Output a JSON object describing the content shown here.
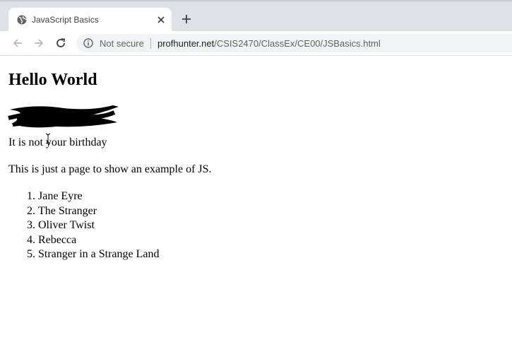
{
  "browser": {
    "tab": {
      "title": "JavaScript Basics",
      "favicon": "globe-icon",
      "close_icon": "close-icon"
    },
    "new_tab_icon": "plus-icon",
    "nav": {
      "back_icon": "back-arrow-icon",
      "forward_icon": "forward-arrow-icon",
      "reload_icon": "reload-icon"
    },
    "address_bar": {
      "security_icon": "info-icon",
      "security_label": "Not secure",
      "url_host": "profhunter.net",
      "url_path": "/CSIS2470/ClassEx/CE00/JSBasics.html"
    }
  },
  "page": {
    "heading": "Hello World",
    "birthday_text": "It is not your birthday",
    "intro_text": "This is just a page to show an example of JS.",
    "books": [
      "Jane Eyre",
      "The Stranger",
      "Oliver Twist",
      "Rebecca",
      "Stranger in a Strange Land"
    ]
  },
  "colors": {
    "tab_strip": "#dee1e6",
    "omnibox": "#f1f3f4",
    "text": "#000000"
  }
}
